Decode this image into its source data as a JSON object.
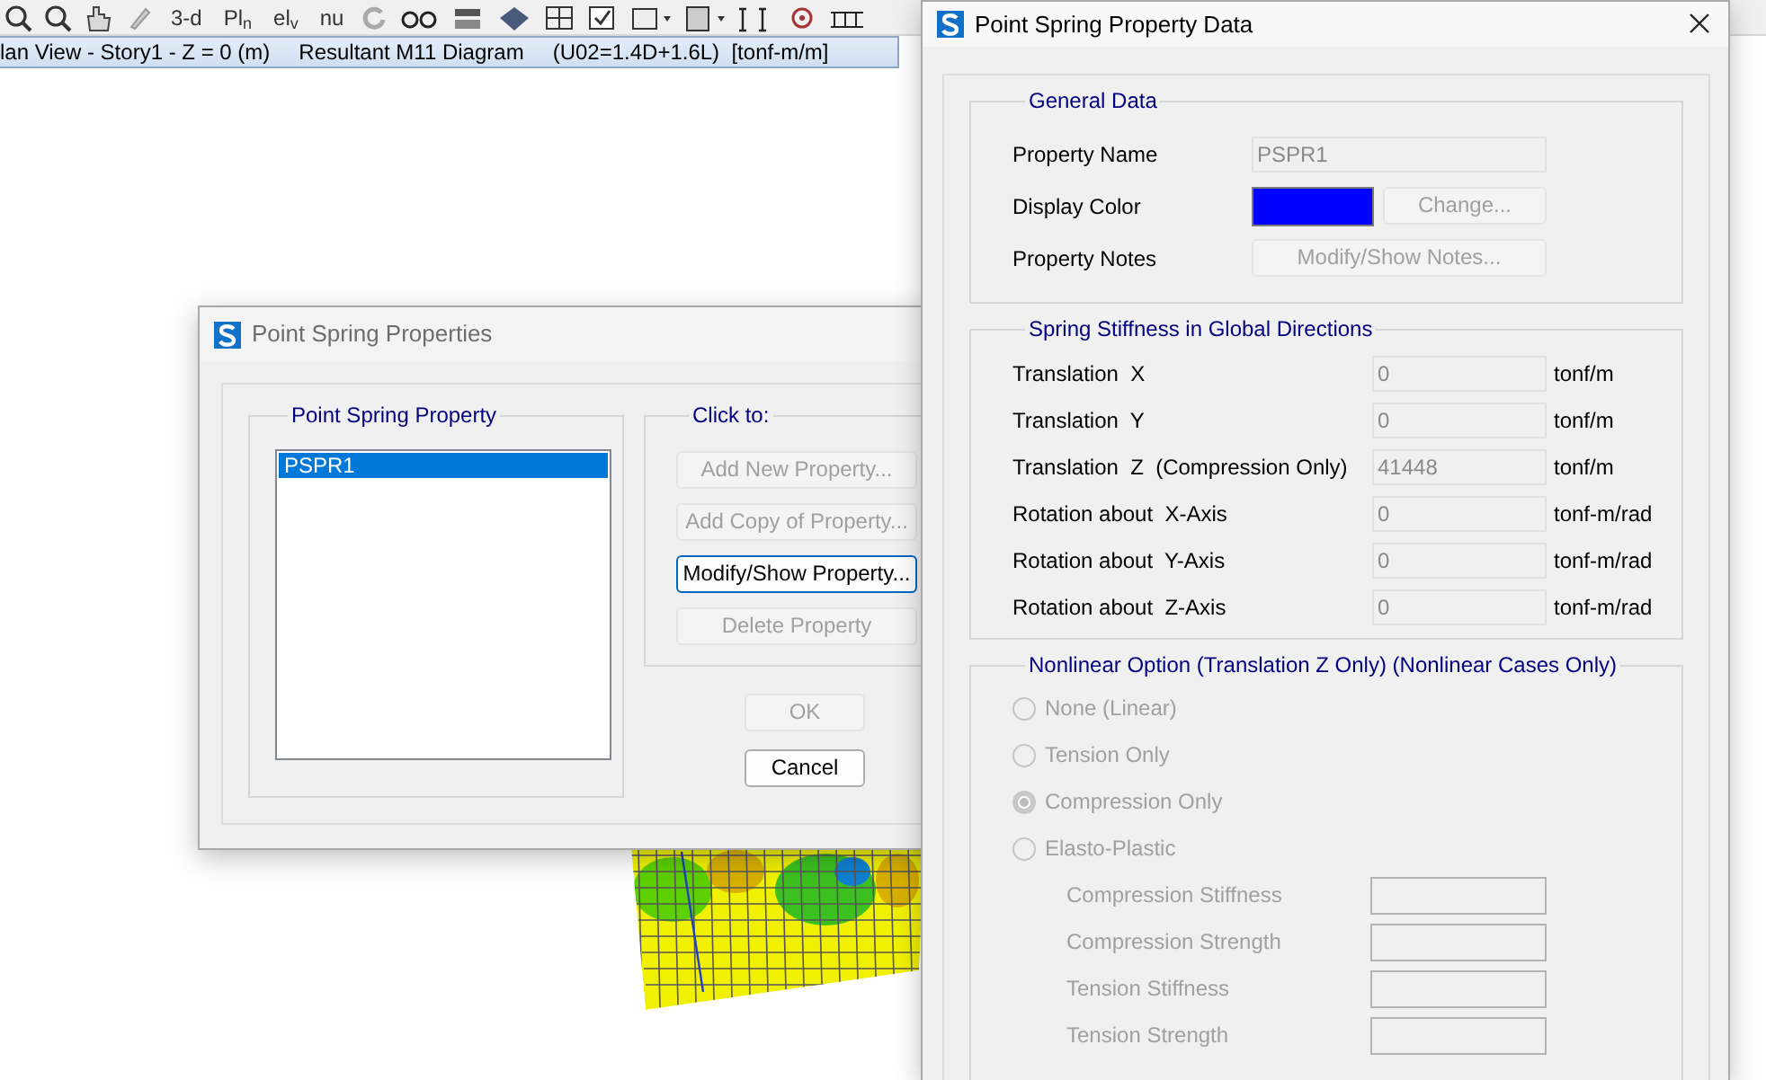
{
  "toolbar": {
    "text_buttons": [
      "3-d",
      "Pl$_{n}$",
      "el$_{v}$",
      "nu"
    ]
  },
  "view_tab": {
    "parts": [
      "lan View - Story1 - Z = 0 (m)",
      "Resultant M11 Diagram",
      "(U02=1.4D+1.6L)  [tonf-m/m]"
    ]
  },
  "properties_dialog": {
    "title": "Point Spring Properties",
    "list_group": {
      "title": "Point Spring Property",
      "items": [
        {
          "label": "PSPR1",
          "selected": true
        }
      ]
    },
    "click_group": {
      "title": "Click to:",
      "buttons": [
        {
          "label": "Add New Property...",
          "disabled": true,
          "focused": false
        },
        {
          "label": "Add Copy of Property...",
          "disabled": true,
          "focused": false
        },
        {
          "label": "Modify/Show Property...",
          "disabled": false,
          "focused": true
        },
        {
          "label": "Delete Property",
          "disabled": true,
          "focused": false
        }
      ]
    },
    "ok_button": {
      "label": "OK",
      "disabled": true
    },
    "cancel_button": {
      "label": "Cancel",
      "disabled": false
    }
  },
  "data_dialog": {
    "title": "Point Spring Property Data",
    "general": {
      "title": "General Data",
      "property_name": {
        "label": "Property Name",
        "value": "PSPR1",
        "disabled": true
      },
      "display_color": {
        "label": "Display Color",
        "color": "#0000ff",
        "button": {
          "label": "Change...",
          "disabled": true
        }
      },
      "property_notes": {
        "label": "Property Notes",
        "button": {
          "label": "Modify/Show Notes...",
          "disabled": true
        }
      }
    },
    "stiffness": {
      "title": "Spring Stiffness in Global Directions",
      "rows": [
        {
          "label": "Translation  X",
          "value": "0",
          "unit": "tonf/m"
        },
        {
          "label": "Translation  Y",
          "value": "0",
          "unit": "tonf/m"
        },
        {
          "label": "Translation  Z  (Compression Only)",
          "value": "41448",
          "unit": "tonf/m"
        },
        {
          "label": "Rotation about  X-Axis",
          "value": "0",
          "unit": "tonf-m/rad"
        },
        {
          "label": "Rotation about  Y-Axis",
          "value": "0",
          "unit": "tonf-m/rad"
        },
        {
          "label": "Rotation about  Z-Axis",
          "value": "0",
          "unit": "tonf-m/rad"
        }
      ]
    },
    "nonlinear": {
      "title": "Nonlinear Option  (Translation Z Only)  (Nonlinear Cases Only)",
      "disabled": true,
      "options": [
        {
          "label": "None (Linear)",
          "selected": false
        },
        {
          "label": "Tension Only",
          "selected": false
        },
        {
          "label": "Compression Only",
          "selected": true
        },
        {
          "label": "Elasto-Plastic",
          "selected": false
        }
      ],
      "params": [
        {
          "label": "Compression Stiffness"
        },
        {
          "label": "Compression Strength"
        },
        {
          "label": "Tension Stiffness"
        },
        {
          "label": "Tension Strength"
        }
      ]
    }
  }
}
